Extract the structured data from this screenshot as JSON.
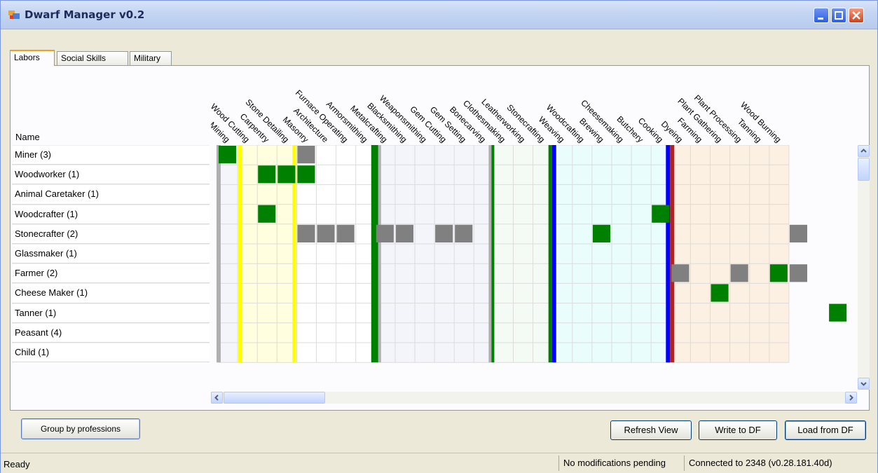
{
  "window": {
    "title": "Dwarf Manager v0.2"
  },
  "tabs": [
    {
      "label": "Labors",
      "active": true
    },
    {
      "label": "Social Skills",
      "active": false
    },
    {
      "label": "Military",
      "active": false
    }
  ],
  "grid": {
    "name_header": "Name",
    "columns": [
      "Mining",
      "Wood Cutting",
      "Carpentry",
      "Stone Detailing",
      "Masonry",
      "Architecture",
      "Furnace Operating",
      "Armorsmithing",
      "Metalcrafting",
      "Blacksmithing",
      "Weaponsmithing",
      "Gem Cutting",
      "Gem Setting",
      "Bonecarving",
      "Clothesmaking",
      "Leatherworking",
      "Stonecrafting",
      "Weaving",
      "Woodcrafting",
      "Brewing",
      "Cheesemaking",
      "Butchery",
      "Cooking",
      "Dyeing",
      "Farming",
      "Plant Gathering",
      "Plant Processing",
      "Tanning",
      "Wood Burning"
    ],
    "rows": [
      {
        "name": "Miner (3)"
      },
      {
        "name": "Woodworker (1)"
      },
      {
        "name": "Animal Caretaker (1)"
      },
      {
        "name": "Woodcrafter (1)"
      },
      {
        "name": "Stonecrafter (2)"
      },
      {
        "name": "Glassmaker (1)"
      },
      {
        "name": "Farmer (2)"
      },
      {
        "name": "Cheese Maker (1)"
      },
      {
        "name": "Tanner (1)"
      },
      {
        "name": "Peasant (4)"
      },
      {
        "name": "Child (1)"
      }
    ],
    "colors": {
      "enabled": "#008000",
      "partial": "#808080",
      "yellow": "#ffff00",
      "blue": "#0000ff",
      "red": "#b22222"
    }
  },
  "buttons": {
    "group": "Group by professions",
    "refresh": "Refresh View",
    "write": "Write to DF",
    "load": "Load from DF"
  },
  "status": {
    "ready": "Ready",
    "modifications": "No modifications pending",
    "connection": "Connected to 2348 (v0.28.181.40d)"
  }
}
